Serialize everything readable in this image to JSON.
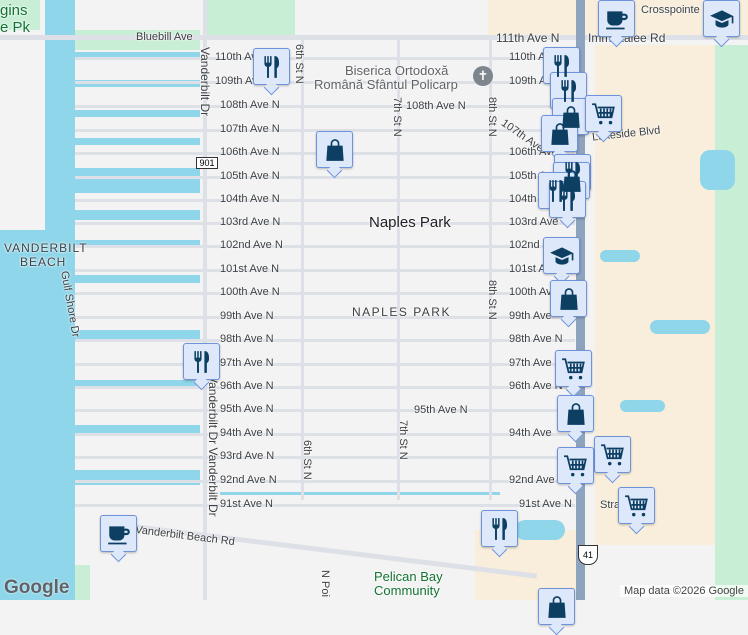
{
  "map": {
    "places": {
      "wiggins_a": "gins",
      "wiggins_b": "e Pk",
      "church_a": "Biserica Ortodoxă",
      "church_b": "Română Sfântul Policarp",
      "naples_park": "Naples Park",
      "naples_park_area": "NAPLES PARK",
      "vanderbilt_a": "VANDERBILT",
      "vanderbilt_b": "BEACH",
      "crosspointe": "Crosspointe",
      "pelican_a": "Pelican Bay",
      "pelican_b": "Community"
    },
    "streets": {
      "bluebill": "Bluebill Ave",
      "ave111": "111th Ave N",
      "immokalee": "Immokalee Rd",
      "vanderbilt_dr": "Vanderbilt Dr",
      "vanderbilt_dr2": "Vanderbilt Dr Vanderbilt Dr",
      "gulf_shore": "Gulf Shore Dr",
      "st6": "6th St N",
      "st7": "7th St N",
      "st8": "8th St N",
      "ave107_curve": "107th Ave",
      "ave95_mid": "95th Ave N",
      "ave108_mid": "108th Ave N",
      "lakeside": "Lakeside Blvd",
      "strat": "Strat",
      "vbeach_rd": "Vanderbilt Beach Rd",
      "n_point": "N Poi"
    },
    "avenues_left": [
      "110th Ave",
      "109th Ave",
      "108th Ave N",
      "107th Ave N",
      "106th Ave N",
      "105th Ave N",
      "104th Ave N",
      "103rd Ave N",
      "102nd Ave N",
      "101st Ave N",
      "100th Ave N",
      "99th Ave N",
      "98th Ave N",
      "97th Ave N",
      "96th Ave N",
      "95th Ave N",
      "94th Ave N",
      "93rd Ave N",
      "92nd Ave N",
      "91st Ave N"
    ],
    "avenues_right": [
      "110th A",
      "109th A",
      "106th Ave",
      "105th Ave",
      "104th",
      "103rd Ave",
      "102nd",
      "101st A",
      "100th Ave",
      "99th Ave",
      "98th Ave N",
      "97th Ave",
      "96th Ave N",
      "94th Ave",
      "92nd Ave",
      "91st Ave N"
    ],
    "shields": {
      "r901": "901",
      "us41": "41"
    },
    "attribution": "Map data ©2026 Google",
    "logo": "Google",
    "markers": [
      "restaurant",
      "shopping",
      "coffee",
      "school",
      "restaurant",
      "restaurant",
      "shopping",
      "grocery",
      "shopping",
      "restaurant",
      "shopping",
      "restaurant",
      "restaurant",
      "school",
      "shopping",
      "restaurant",
      "grocery",
      "shopping",
      "grocery",
      "grocery",
      "grocery",
      "restaurant",
      "coffee",
      "shopping"
    ],
    "colors": {
      "water": "#8fd6ea",
      "marker_bg": "#dde8fb",
      "marker_border": "#6f93da",
      "icon": "#0d3f63"
    }
  }
}
